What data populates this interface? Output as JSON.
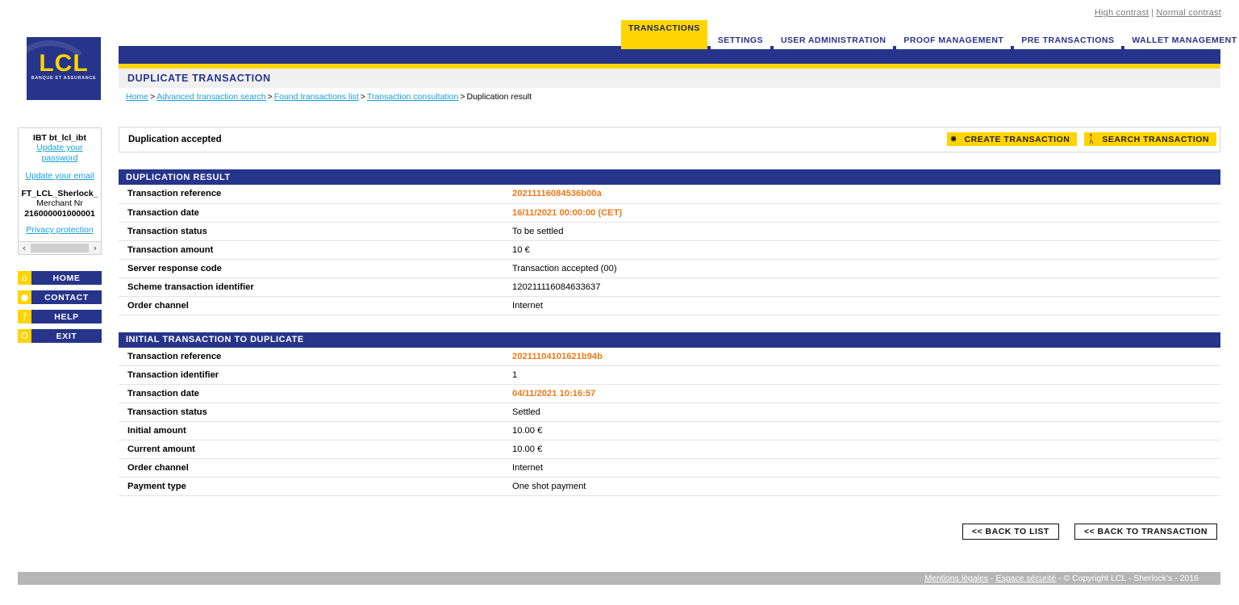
{
  "topbar": {
    "high_contrast": "High contrast",
    "separator": "|",
    "normal_contrast": "Normal contrast"
  },
  "logo": {
    "name": "LCL",
    "tagline": "BANQUE ET ASSURANCE"
  },
  "tabs": [
    {
      "label": "TRANSACTIONS",
      "active": true
    },
    {
      "label": "SETTINGS",
      "active": false
    },
    {
      "label": "USER ADMINISTRATION",
      "active": false
    },
    {
      "label": "PROOF MANAGEMENT",
      "active": false
    },
    {
      "label": "PRE TRANSACTIONS",
      "active": false
    },
    {
      "label": "WALLET MANAGEMENT",
      "active": false
    }
  ],
  "page": {
    "title": "DUPLICATE TRANSACTION"
  },
  "breadcrumb": {
    "items": [
      {
        "label": "Home",
        "link": true
      },
      {
        "label": "Advanced transaction search",
        "link": true
      },
      {
        "label": "Found transactions list",
        "link": true
      },
      {
        "label": "Transaction consultation",
        "link": true
      },
      {
        "label": "Duplication result",
        "link": false
      }
    ],
    "separator": ">"
  },
  "sidebar": {
    "user": {
      "username": "IBT bt_lcl_ibt",
      "update_password": "Update your password",
      "update_email": "Update your email",
      "merchant_name": "FT_LCL_Sherlock_",
      "merchant_label": "Merchant Nr",
      "merchant_number": "216000001000001",
      "privacy": "Privacy protection"
    },
    "scrollbar": {
      "left_arrow": "‹",
      "right_arrow": "›"
    },
    "nav": [
      {
        "label": "HOME",
        "icon": "home-icon",
        "glyph": "⌂"
      },
      {
        "label": "CONTACT",
        "icon": "speech-bubble-icon",
        "glyph": "●"
      },
      {
        "label": "HELP",
        "icon": "question-mark-icon",
        "glyph": "?"
      },
      {
        "label": "EXIT",
        "icon": "power-icon",
        "glyph": "⭘"
      }
    ]
  },
  "main": {
    "status_message": "Duplication accepted",
    "actions": [
      {
        "label": "CREATE TRANSACTION",
        "icon": "star-burst-icon",
        "glyph": "✸"
      },
      {
        "label": "SEARCH TRANSACTION",
        "icon": "walking-person-icon",
        "glyph": "Ὣ6"
      }
    ],
    "sections": [
      {
        "title": "DUPLICATION RESULT",
        "rows": [
          {
            "key": "Transaction reference",
            "value": "20211116084536b00a",
            "highlight": true
          },
          {
            "key": "Transaction date",
            "value": "16/11/2021 00:00:00 (CET)",
            "highlight": true
          },
          {
            "key": "Transaction status",
            "value": "To be settled",
            "highlight": false
          },
          {
            "key": "Transaction amount",
            "value": "10 €",
            "highlight": false
          },
          {
            "key": "Server response code",
            "value": "Transaction accepted (00)",
            "highlight": false
          },
          {
            "key": "Scheme transaction identifier",
            "value": "120211116084633637",
            "highlight": false
          },
          {
            "key": "Order channel",
            "value": "Internet",
            "highlight": false
          }
        ]
      },
      {
        "title": "INITIAL TRANSACTION TO DUPLICATE",
        "rows": [
          {
            "key": "Transaction reference",
            "value": "20211104101621b94b",
            "highlight": true
          },
          {
            "key": "Transaction identifier",
            "value": "1",
            "highlight": false
          },
          {
            "key": "Transaction date",
            "value": "04/11/2021 10:16:57",
            "highlight": true
          },
          {
            "key": "Transaction status",
            "value": "Settled",
            "highlight": false
          },
          {
            "key": "Initial amount",
            "value": "10.00  €",
            "highlight": false
          },
          {
            "key": "Current amount",
            "value": "10.00  €",
            "highlight": false
          },
          {
            "key": "Order channel",
            "value": "Internet",
            "highlight": false
          },
          {
            "key": "Payment type",
            "value": "One shot payment",
            "highlight": false
          }
        ]
      }
    ],
    "bottom_buttons": [
      {
        "label": "<< BACK TO LIST"
      },
      {
        "label": "<< BACK TO TRANSACTION"
      }
    ]
  },
  "footer": {
    "legal": "Mentions légales",
    "sep1": " - ",
    "security": "Espace sécurité",
    "copyright": " - © Copyright LCL - Sherlock's - 2016"
  },
  "colors": {
    "brand_blue": "#26348a",
    "brand_yellow": "#ffd400",
    "highlight_orange": "#f07818",
    "link_blue": "#1a9fd4",
    "footer_gray": "#b6b6b6"
  }
}
